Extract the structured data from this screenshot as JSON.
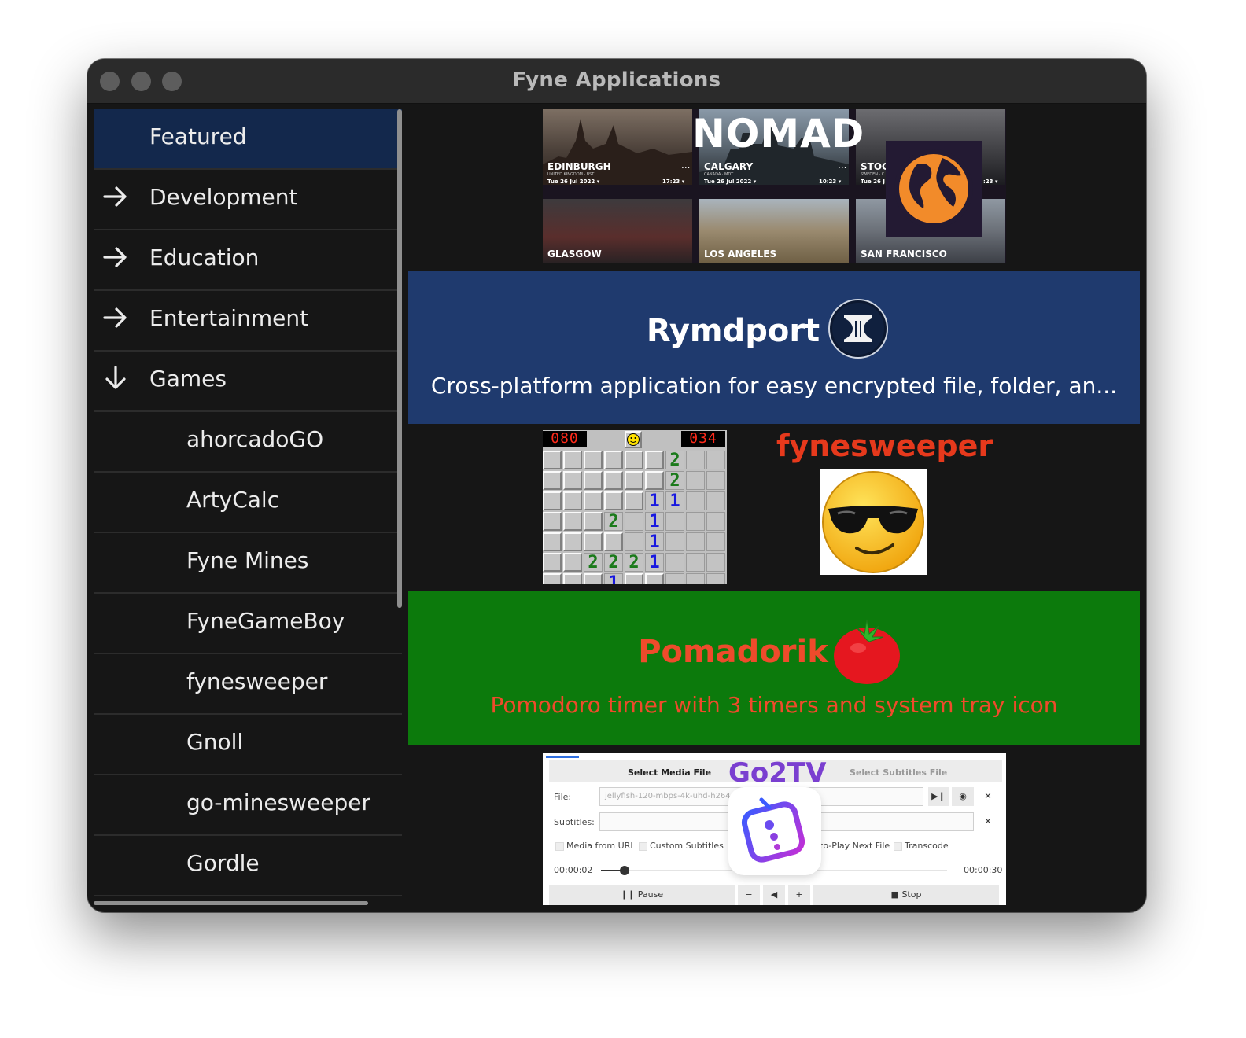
{
  "window": {
    "title": "Fyne Applications"
  },
  "sidebar": {
    "items": [
      {
        "label": "Featured",
        "icon": "none",
        "level": 0,
        "selected": true
      },
      {
        "label": "Development",
        "icon": "arrow-right-icon",
        "level": 0
      },
      {
        "label": "Education",
        "icon": "arrow-right-icon",
        "level": 0
      },
      {
        "label": "Entertainment",
        "icon": "arrow-right-icon",
        "level": 0
      },
      {
        "label": "Games",
        "icon": "arrow-down-icon",
        "level": 0
      },
      {
        "label": "ahorcadoGO",
        "level": 1
      },
      {
        "label": "ArtyCalc",
        "level": 1
      },
      {
        "label": "Fyne Mines",
        "level": 1
      },
      {
        "label": "FyneGameBoy",
        "level": 1
      },
      {
        "label": "fynesweeper",
        "level": 1
      },
      {
        "label": "Gnoll",
        "level": 1
      },
      {
        "label": "go-minesweeper",
        "level": 1
      },
      {
        "label": "Gordle",
        "level": 1
      }
    ]
  },
  "featured": {
    "nomad": {
      "title": "NOMAD",
      "cities": [
        {
          "name": "EDINBURGH",
          "meta": "UNITED KINGDOM · BST",
          "date": "Tue 26 Jul 2022 ▾",
          "time": "17:23 ▾"
        },
        {
          "name": "CALGARY",
          "meta": "CANADA · MDT",
          "date": "Tue 26 Jul 2022 ▾",
          "time": "10:23 ▾"
        },
        {
          "name": "STOC",
          "meta": "SWEDEN · C",
          "date": "Tue 26 J",
          "time": ":23 ▾"
        },
        {
          "name": "GLASGOW"
        },
        {
          "name": "LOS ANGELES"
        },
        {
          "name": "SAN FRANCISCO"
        }
      ],
      "dots": "..."
    },
    "rymdport": {
      "title": "Rymdport",
      "subtitle": "Cross-platform application for easy encrypted file, folder, an...",
      "bg": "#1f3a6e"
    },
    "fynesweeper": {
      "title": "fynesweeper",
      "mines_counter": "080",
      "timer": "034"
    },
    "pomadorik": {
      "title": "Pomadorik",
      "subtitle": "Pomodoro timer with 3 timers and system tray icon",
      "bg": "#0c7a0c",
      "fg": "#ee4b2b"
    },
    "go2tv": {
      "title": "Go2TV",
      "tab_media": "Select Media File",
      "tab_subs": "Select Subtitles File",
      "file_label": "File:",
      "file_value": "jellyfish-120-mbps-4k-uhd-h264.m",
      "subs_label": "Subtitles:",
      "check_url": "Media from URL",
      "check_subs": "Custom Subtitles",
      "check_next": "to-Play Next File",
      "check_transcode": "Transcode",
      "time_start": "00:00:02",
      "time_end": "00:00:30",
      "pause": "Pause",
      "stop": "Stop",
      "minus": "−",
      "plus": "+"
    }
  }
}
